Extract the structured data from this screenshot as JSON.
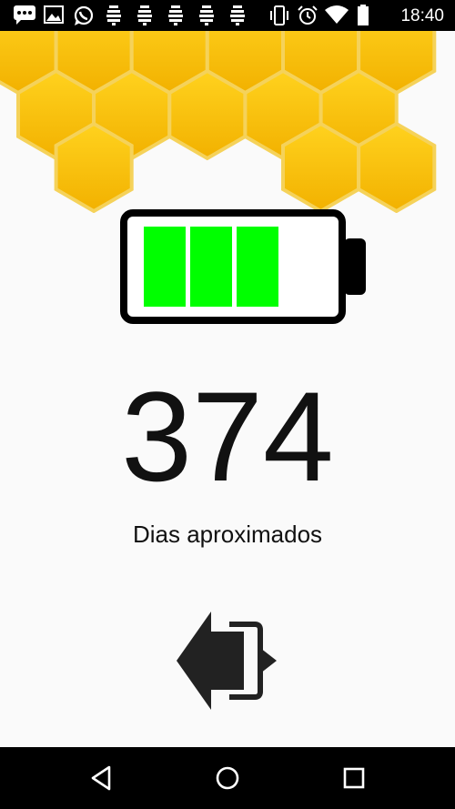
{
  "status_bar": {
    "time": "18:40",
    "icons": [
      "chat-icon",
      "image-icon",
      "whatsapp-icon",
      "beehive-icon",
      "beehive-icon",
      "beehive-icon",
      "beehive-icon",
      "beehive-icon",
      "vibrate-icon",
      "alarm-icon",
      "wifi-icon",
      "battery-icon"
    ]
  },
  "battery": {
    "level_segments": 3,
    "total_segments": 4,
    "fill_color": "#00ff00",
    "outline_color": "#000000"
  },
  "main": {
    "days_value": "374",
    "days_label": "Dias aproximados"
  },
  "exit_button": {
    "icon": "exit-arrow-icon"
  },
  "nav_bar": {
    "items": [
      "back-icon",
      "home-icon",
      "recents-icon"
    ]
  },
  "theme": {
    "honeycomb_color": "#f9c21a",
    "honeycomb_dark": "#eaa800"
  }
}
